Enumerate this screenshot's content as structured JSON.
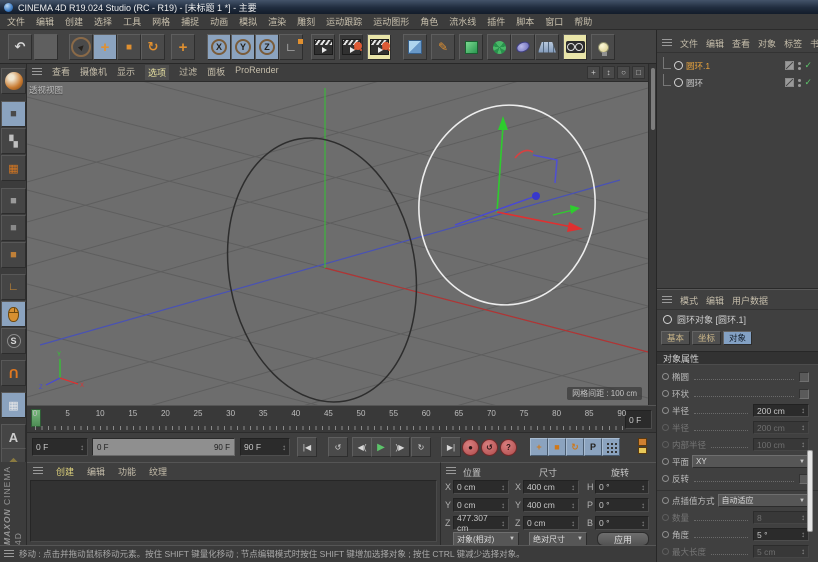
{
  "window": {
    "title": "CINEMA 4D R19.024 Studio (RC - R19) - [未标题 1 *] - 主要"
  },
  "menubar": {
    "items": [
      "文件",
      "编辑",
      "创建",
      "选择",
      "工具",
      "网格",
      "捕捉",
      "动画",
      "模拟",
      "渲染",
      "雕刻",
      "运动跟踪",
      "运动图形",
      "角色",
      "流水线",
      "插件",
      "脚本",
      "窗口",
      "帮助"
    ]
  },
  "toolbar": {
    "buttons": [
      {
        "name": "undo-button",
        "icon": "undo-icon",
        "glyph": "↶"
      },
      {
        "name": "color-swatch",
        "icon": "blank"
      },
      {
        "name": "live-selection-tool",
        "icon": "cursor-icon"
      },
      {
        "name": "move-tool",
        "icon": "move-icon",
        "glyph": "+",
        "selected": true
      },
      {
        "name": "scale-tool",
        "icon": "scale-icon",
        "glyph": "■"
      },
      {
        "name": "rotate-tool",
        "icon": "rotate-icon",
        "glyph": "↻"
      },
      {
        "name": "last-tool",
        "icon": "plus-icon",
        "glyph": "+"
      },
      {
        "name": "lock-x-axis-button",
        "label": "X",
        "selected": true
      },
      {
        "name": "lock-y-axis-button",
        "label": "Y",
        "selected": true
      },
      {
        "name": "lock-z-axis-button",
        "label": "Z",
        "selected": true
      },
      {
        "name": "coordinate-system-button",
        "icon": "coord-icon",
        "glyph": "∟"
      },
      {
        "name": "render-view-button",
        "icon": "clapperboard-icon"
      },
      {
        "name": "render-picture-viewer-button",
        "icon": "clapperboard-splat-icon",
        "variant": "dark"
      },
      {
        "name": "render-settings-button",
        "icon": "clapperboard-splat-icon",
        "variant": "yellow"
      },
      {
        "name": "add-primitive-button",
        "icon": "cube-icon"
      },
      {
        "name": "add-spline-button",
        "icon": "pen-icon",
        "glyph": "✎"
      },
      {
        "name": "add-generator-button",
        "icon": "green-cube-icon"
      },
      {
        "name": "add-deformer-button",
        "icon": "deformer-icon"
      },
      {
        "name": "add-field-button",
        "icon": "field-icon"
      },
      {
        "name": "add-environment-button",
        "icon": "floor-icon"
      },
      {
        "name": "add-camera-button",
        "icon": "camera-icon",
        "variant": "yellow"
      },
      {
        "name": "add-light-button",
        "icon": "light-icon"
      }
    ]
  },
  "left_toolbar": {
    "items": [
      {
        "name": "paint-setup-wizard",
        "icon": "ball-icon"
      },
      {
        "name": "model-mode-button",
        "icon": "model-cube-icon",
        "glyph": "■",
        "selected": true
      },
      {
        "name": "texture-mode-button",
        "icon": "texture-cube-icon",
        "glyph": "▚"
      },
      {
        "name": "workplane-mode-button",
        "icon": "workplane-icon",
        "glyph": "▦"
      },
      {
        "name": "points-mode-button",
        "icon": "points-cube-icon",
        "glyph": "■"
      },
      {
        "name": "edges-mode-button",
        "icon": "edges-cube-icon",
        "glyph": "■"
      },
      {
        "name": "polygons-mode-button",
        "icon": "polygon-cube-icon",
        "glyph": "■"
      },
      {
        "name": "enable-axis-button",
        "icon": "axis-icon",
        "glyph": "∟"
      },
      {
        "name": "tweak-mode-button",
        "icon": "mouse-icon",
        "selected": true
      },
      {
        "name": "snap-button",
        "icon": "snap-icon",
        "glyph": "S"
      },
      {
        "name": "magnet-button",
        "icon": "magnet-icon",
        "glyph": "U"
      },
      {
        "name": "workplane-lock-button",
        "icon": "workplane-lock-icon",
        "glyph": "▦",
        "selected": true
      },
      {
        "name": "axis-lock-button",
        "icon": "a-lock-icon",
        "glyph": "A"
      },
      {
        "name": "quantize-button",
        "icon": "net-icon",
        "glyph": "◆"
      }
    ]
  },
  "viewport": {
    "menu": {
      "items": [
        "查看",
        "摄像机",
        "显示",
        "选项",
        "过滤",
        "面板",
        "ProRender"
      ],
      "active": "选项"
    },
    "nav_icons": [
      {
        "name": "viewport-pan-icon",
        "glyph": "+"
      },
      {
        "name": "viewport-zoom-icon",
        "glyph": "↕"
      },
      {
        "name": "viewport-rotate-icon",
        "glyph": "○"
      },
      {
        "name": "viewport-maximize-icon",
        "glyph": "□"
      }
    ],
    "view_label": "透视视图",
    "grid_label": "网格间距 : 100 cm",
    "axis_labels": {
      "x": "X",
      "y": "Y",
      "z": "Z"
    }
  },
  "object_manager": {
    "menu": [
      "文件",
      "编辑",
      "查看",
      "对象",
      "标签",
      "书签"
    ],
    "objects": [
      {
        "name": "圆环.1",
        "selected": true
      },
      {
        "name": "圆环",
        "selected": false
      }
    ]
  },
  "attributes": {
    "menu": [
      "模式",
      "编辑",
      "用户数据"
    ],
    "object_title": "圆环对象 [圆环.1]",
    "tabs": [
      "基本",
      "坐标",
      "对象"
    ],
    "active_tab": "对象",
    "section": "对象属性",
    "rows": [
      {
        "label": "椭圆",
        "type": "checkbox",
        "enabled": true
      },
      {
        "label": "环状",
        "type": "checkbox",
        "enabled": true
      },
      {
        "label": "半径",
        "type": "field",
        "value": "200 cm",
        "enabled": true
      },
      {
        "label": "半径",
        "type": "field",
        "value": "200 cm",
        "enabled": false
      },
      {
        "label": "内部半径",
        "type": "field",
        "value": "100 cm",
        "enabled": false
      },
      {
        "label": "平面",
        "type": "dropdown",
        "value": "XY",
        "enabled": true
      },
      {
        "label": "反转",
        "type": "checkbox",
        "enabled": true
      },
      {
        "separator": true
      },
      {
        "label": "点插值方式",
        "type": "dropdown",
        "value": "自动适应",
        "enabled": true
      },
      {
        "label": "数量",
        "type": "field",
        "value": "8",
        "enabled": false
      },
      {
        "label": "角度",
        "type": "field",
        "value": "5 °",
        "enabled": true
      },
      {
        "label": "最大长度",
        "type": "field",
        "value": "5 cm",
        "enabled": false
      }
    ]
  },
  "timeline": {
    "tick_frames": [
      0,
      5,
      10,
      15,
      20,
      25,
      30,
      35,
      40,
      45,
      50,
      55,
      60,
      65,
      70,
      75,
      80,
      85,
      90
    ],
    "current_frame": "0 F",
    "range_start": "0 F",
    "range_end": "90 F",
    "max_frame": "90 F"
  },
  "transport": {
    "buttons": [
      {
        "name": "goto-start-button",
        "glyph": "|◀"
      },
      {
        "name": "play-backward-button",
        "glyph": "↺"
      },
      {
        "name": "previous-frame-button",
        "glyph": "◀("
      },
      {
        "name": "play-button",
        "glyph": "▶",
        "play": true
      },
      {
        "name": "next-frame-button",
        "glyph": ")▶"
      },
      {
        "name": "loop-button",
        "glyph": "↻"
      },
      {
        "name": "goto-end-button",
        "glyph": "▶|"
      }
    ],
    "record_buttons": [
      {
        "name": "record-keyframe-button",
        "glyph": "●"
      },
      {
        "name": "autokey-button",
        "glyph": "↺"
      },
      {
        "name": "keying-help-button",
        "glyph": "?"
      }
    ],
    "key_buttons": [
      {
        "name": "key-position-button",
        "glyph": "+"
      },
      {
        "name": "key-scale-button",
        "glyph": "■"
      },
      {
        "name": "key-rotation-button",
        "glyph": "↻"
      },
      {
        "name": "key-parameter-button",
        "glyph": "P"
      },
      {
        "name": "key-pla-button",
        "glyph": "dots"
      }
    ]
  },
  "coordinates": {
    "headers": [
      "位置",
      "尺寸",
      "旋转"
    ],
    "rows": [
      {
        "pl": "X",
        "pv": "0 cm",
        "sl": "X",
        "sv": "400 cm",
        "rl": "H",
        "rv": "0 °"
      },
      {
        "pl": "Y",
        "pv": "0 cm",
        "sl": "Y",
        "sv": "400 cm",
        "rl": "P",
        "rv": "0 °"
      },
      {
        "pl": "Z",
        "pv": "477.307 cm",
        "sl": "Z",
        "sv": "0 cm",
        "rl": "B",
        "rv": "0 °"
      }
    ],
    "position_mode": "对象(相对)",
    "size_mode": "绝对尺寸",
    "apply": "应用"
  },
  "materials": {
    "menu": [
      "创建",
      "编辑",
      "功能",
      "纹理"
    ],
    "active": "创建"
  },
  "branding": {
    "line1": "MAXON",
    "line2": "CINEMA 4D"
  },
  "statusbar": {
    "text": "移动 : 点击并拖动鼠标移动元素。按住 SHIFT 键量化移动 ; 节点编辑模式时按住 SHIFT 键增加选择对象 ; 按住 CTRL 键减少选择对象。"
  }
}
